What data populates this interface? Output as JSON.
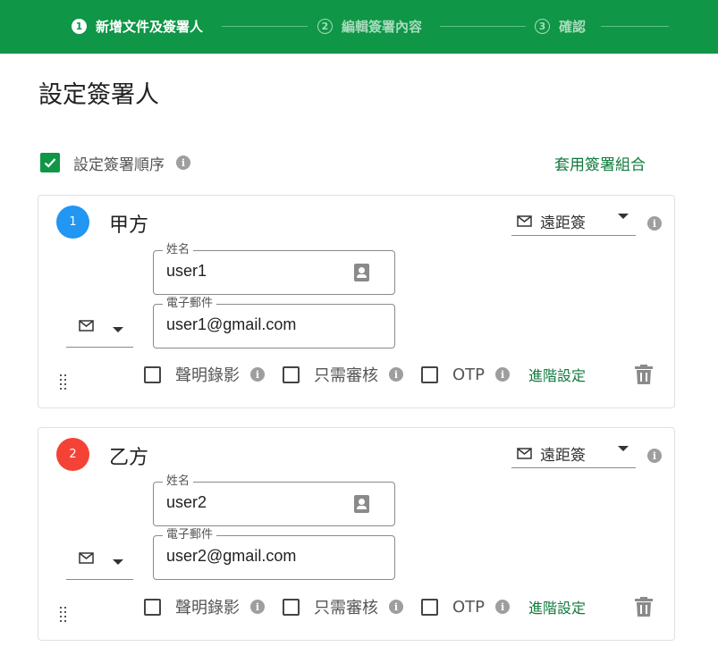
{
  "stepper": {
    "steps": [
      {
        "number": "1",
        "label": "新增文件及簽署人",
        "state": "active"
      },
      {
        "number": "2",
        "label": "編輯簽署內容",
        "state": "inactive"
      },
      {
        "number": "3",
        "label": "確認",
        "state": "inactive"
      }
    ]
  },
  "page": {
    "title": "設定簽署人",
    "order_label": "設定簽署順序",
    "order_checked": true,
    "apply_group_label": "套用簽署組合"
  },
  "colors": {
    "primary": "#0f9647",
    "link": "#0f7a3d",
    "badge_1": "#2196f3",
    "badge_2": "#f44336"
  },
  "signers": [
    {
      "index": "1",
      "name": "甲方",
      "method": "遠距簽",
      "name_field_label": "姓名",
      "name_value": "user1",
      "email_field_label": "電子郵件",
      "email_value": "user1@gmail.com",
      "options": [
        {
          "label": "聲明錄影",
          "checked": false
        },
        {
          "label": "只需審核",
          "checked": false
        },
        {
          "label": "OTP",
          "checked": false
        }
      ],
      "advanced_label": "進階設定"
    },
    {
      "index": "2",
      "name": "乙方",
      "method": "遠距簽",
      "name_field_label": "姓名",
      "name_value": "user2",
      "email_field_label": "電子郵件",
      "email_value": "user2@gmail.com",
      "options": [
        {
          "label": "聲明錄影",
          "checked": false
        },
        {
          "label": "只需審核",
          "checked": false
        },
        {
          "label": "OTP",
          "checked": false
        }
      ],
      "advanced_label": "進階設定"
    }
  ]
}
